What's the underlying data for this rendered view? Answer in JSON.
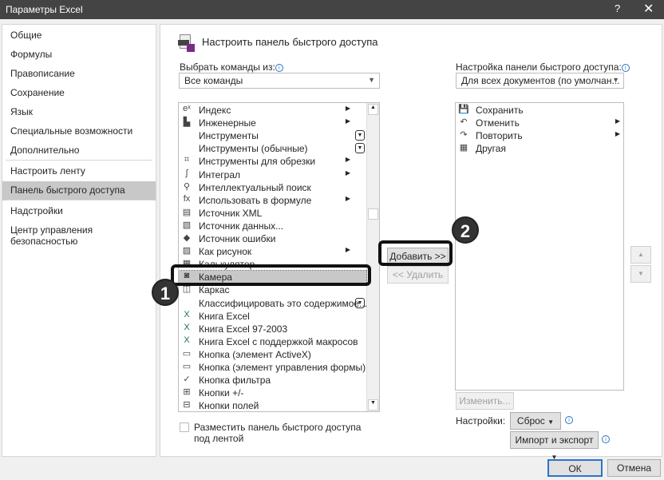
{
  "window": {
    "title": "Параметры Excel",
    "help": "?",
    "close": "✕"
  },
  "sidebar": {
    "items": [
      "Общие",
      "Формулы",
      "Правописание",
      "Сохранение",
      "Язык",
      "Специальные возможности",
      "Дополнительно",
      "Настроить ленту",
      "Панель быстрого доступа",
      "Надстройки",
      "Центр управления безопасностью"
    ]
  },
  "main": {
    "heading": "Настроить панель быстрого доступа",
    "choose_label": "Выбрать команды из:",
    "choose_value": "Все команды",
    "customize_label": "Настройка панели быстрого доступа:",
    "customize_value": "Для всех документов (по умолчан...",
    "commands": [
      {
        "icon": "eˣ",
        "label": "Индекс",
        "sub": true
      },
      {
        "icon": "▙",
        "label": "Инженерные",
        "sub": true
      },
      {
        "icon": "",
        "label": "Инструменты",
        "dd": true
      },
      {
        "icon": "",
        "label": "Инструменты (обычные)",
        "dd": true
      },
      {
        "icon": "⌗",
        "label": "Инструменты для обрезки",
        "sub": true
      },
      {
        "icon": "∫",
        "label": "Интеграл",
        "sub": true
      },
      {
        "icon": "⚲",
        "label": "Интеллектуальный поиск"
      },
      {
        "icon": "fx",
        "label": "Использовать в формуле",
        "sub": true
      },
      {
        "icon": "▤",
        "label": "Источник XML"
      },
      {
        "icon": "▧",
        "label": "Источник данных..."
      },
      {
        "icon": "◆",
        "label": "Источник ошибки"
      },
      {
        "icon": "▨",
        "label": "Как рисунок",
        "sub": true
      },
      {
        "icon": "▦",
        "label": "Калькулятор"
      },
      {
        "icon": "◙",
        "label": "Камера"
      },
      {
        "icon": "◫",
        "label": "Каркас"
      },
      {
        "icon": "",
        "label": "Классифицировать это содержимое...",
        "dd": true
      },
      {
        "icon": "X",
        "label": "Книга Excel"
      },
      {
        "icon": "X",
        "label": "Книга Excel 97-2003"
      },
      {
        "icon": "X",
        "label": "Книга Excel с поддержкой макросов"
      },
      {
        "icon": "▭",
        "label": "Кнопка (элемент ActiveX)"
      },
      {
        "icon": "▭",
        "label": "Кнопка (элемент управления формы)"
      },
      {
        "icon": "✓",
        "label": "Кнопка фильтра"
      },
      {
        "icon": "⊞",
        "label": "Кнопки +/-"
      },
      {
        "icon": "⊟",
        "label": "Кнопки полей"
      }
    ],
    "qat": [
      {
        "icon": "💾",
        "label": "Сохранить"
      },
      {
        "icon": "↶",
        "label": "Отменить",
        "sub": true
      },
      {
        "icon": "↷",
        "label": "Повторить",
        "sub": true
      },
      {
        "icon": "▦",
        "label": "Другая"
      }
    ],
    "add": "Добавить >>",
    "remove": "<< Удалить",
    "modify": "Изменить...",
    "settings_label": "Настройки:",
    "reset": "Сброс",
    "import_export": "Импорт и экспорт",
    "below_ribbon": "Разместить панель быстрого доступа под лентой"
  },
  "annotations": [
    "1",
    "2"
  ],
  "footer": {
    "ok": "ОК",
    "cancel": "Отмена"
  }
}
